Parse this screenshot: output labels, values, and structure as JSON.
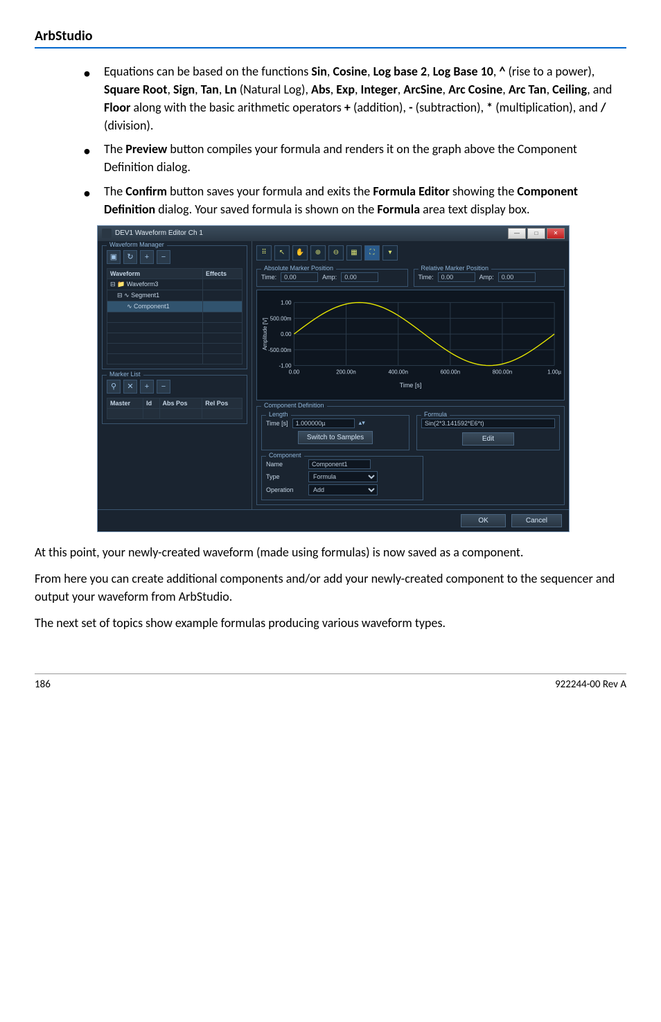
{
  "doc": {
    "header": "ArbStudio",
    "bullets": [
      {
        "parts": [
          {
            "t": "Equations can be based on the functions "
          },
          {
            "t": "Sin",
            "b": true
          },
          {
            "t": ", "
          },
          {
            "t": "Cosine",
            "b": true
          },
          {
            "t": ", "
          },
          {
            "t": "Log base 2",
            "b": true
          },
          {
            "t": ", "
          },
          {
            "t": "Log Base 10",
            "b": true
          },
          {
            "t": ", "
          },
          {
            "t": "^",
            "b": true
          },
          {
            "t": " (rise to a power), "
          },
          {
            "t": "Square Root",
            "b": true
          },
          {
            "t": ", "
          },
          {
            "t": "Sign",
            "b": true
          },
          {
            "t": ", "
          },
          {
            "t": "Tan",
            "b": true
          },
          {
            "t": ", "
          },
          {
            "t": "Ln",
            "b": true
          },
          {
            "t": " (Natural Log), "
          },
          {
            "t": "Abs",
            "b": true
          },
          {
            "t": ", "
          },
          {
            "t": "Exp",
            "b": true
          },
          {
            "t": ", "
          },
          {
            "t": "Integer",
            "b": true
          },
          {
            "t": ", "
          },
          {
            "t": "ArcSine",
            "b": true
          },
          {
            "t": ", "
          },
          {
            "t": "Arc Cosine",
            "b": true
          },
          {
            "t": ", "
          },
          {
            "t": "Arc Tan",
            "b": true
          },
          {
            "t": ", "
          },
          {
            "t": "Ceiling",
            "b": true
          },
          {
            "t": ", and "
          },
          {
            "t": "Floor",
            "b": true
          },
          {
            "t": " along with the basic arithmetic operators "
          },
          {
            "t": "+",
            "b": true
          },
          {
            "t": " (addition), "
          },
          {
            "t": "-",
            "b": true
          },
          {
            "t": " (subtraction), "
          },
          {
            "t": "*",
            "b": true
          },
          {
            "t": " (multiplication), and "
          },
          {
            "t": "/",
            "b": true
          },
          {
            "t": " (division)."
          }
        ]
      },
      {
        "parts": [
          {
            "t": "The "
          },
          {
            "t": "Preview",
            "b": true
          },
          {
            "t": " button compiles your formula and renders it on the graph above the Component Definition dialog."
          }
        ]
      },
      {
        "parts": [
          {
            "t": "The "
          },
          {
            "t": "Confirm",
            "b": true
          },
          {
            "t": " button saves your formula and exits the "
          },
          {
            "t": "Formula Editor",
            "b": true
          },
          {
            "t": " showing the "
          },
          {
            "t": "Component Definition",
            "b": true
          },
          {
            "t": " dialog. Your saved formula is shown on the "
          },
          {
            "t": "Formula",
            "b": true
          },
          {
            "t": " area text display box."
          }
        ]
      }
    ],
    "para1": "At this point, your newly-created waveform (made using formulas) is now saved as a component.",
    "para2": "From here you can create additional components and/or add your newly-created component to the sequencer and output your waveform from ArbStudio.",
    "para3": "The next set of topics show example formulas producing various waveform types.",
    "footer_left": "186",
    "footer_right": "922244-00 Rev A"
  },
  "app": {
    "title": "DEV1 Waveform Editor Ch 1",
    "wm_group": "Waveform Manager",
    "tree_headers": [
      "Waveform",
      "Effects"
    ],
    "tree": [
      {
        "name": "Waveform3",
        "indent": 0
      },
      {
        "name": "Segment1",
        "indent": 1
      },
      {
        "name": "Component1",
        "indent": 2,
        "selected": true
      }
    ],
    "marker_list_group": "Marker List",
    "marker_headers": [
      "Master",
      "Id",
      "Abs Pos",
      "Rel Pos"
    ],
    "abs_group": "Absolute Marker Position",
    "rel_group": "Relative Marker Position",
    "time_label": "Time:",
    "amp_label": "Amp:",
    "abs_time": "0.00",
    "abs_amp": "0.00",
    "rel_time": "0.00",
    "rel_amp": "0.00",
    "chart_data": {
      "type": "line",
      "title": "",
      "xlabel": "Time [s]",
      "ylabel": "Amplitude [V]",
      "xlim": [
        0,
        1e-06
      ],
      "ylim": [
        -1.0,
        1.0
      ],
      "x_ticks": [
        "0.00",
        "200.00n",
        "400.00n",
        "600.00n",
        "800.00n",
        "1.00µ"
      ],
      "y_ticks": [
        "1.00",
        "500.00m",
        "0.00",
        "-500.00m",
        "-1.00"
      ],
      "series": [
        {
          "name": "Sin(2*3.141592*E6*t)",
          "color": "#e6e600",
          "x": [
            0,
            2.5e-07,
            5e-07,
            7.5e-07,
            1e-06
          ],
          "values": [
            0.0,
            1.0,
            0.0,
            -1.0,
            0.0
          ]
        }
      ]
    },
    "compdef_group": "Component Definition",
    "length_group": "Length",
    "time_s_label": "Time [s]",
    "time_s_value": "1.000000µ",
    "switch_btn": "Switch to Samples",
    "formula_group": "Formula",
    "formula_text": "Sin(2*3.141592*E6*t)",
    "edit_btn": "Edit",
    "component_group": "Component",
    "name_label": "Name",
    "name_value": "Component1",
    "type_label": "Type",
    "type_value": "Formula",
    "op_label": "Operation",
    "op_value": "Add",
    "ok_btn": "OK",
    "cancel_btn": "Cancel"
  }
}
